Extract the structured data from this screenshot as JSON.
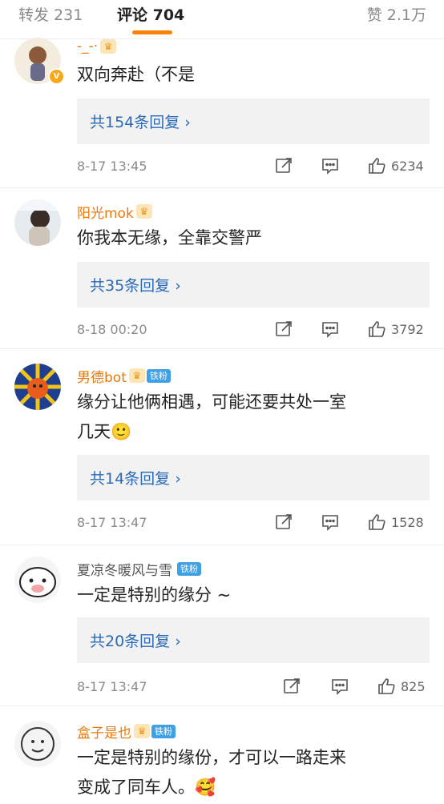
{
  "tabs": {
    "repost": "转发 231",
    "comment": "评论 704",
    "like": "赞 2.1万"
  },
  "comments": [
    {
      "username": "-_-·",
      "text_lines": [
        "双向奔赴（不是"
      ],
      "reply_label": "共154条回复 ›",
      "timestamp": "8-17 13:45",
      "likes": "6234",
      "verified": "V"
    },
    {
      "username": "阳光mok",
      "text_lines": [
        "你我本无缘，全靠交警严"
      ],
      "reply_label": "共35条回复 ›",
      "timestamp": "8-18 00:20",
      "likes": "3792"
    },
    {
      "username": "男德bot",
      "badge": "铁粉",
      "text_lines": [
        "缘分让他俩相遇，可能还要共处一室",
        "几天🙂"
      ],
      "reply_label": "共14条回复 ›",
      "timestamp": "8-17 13:47",
      "likes": "1528"
    },
    {
      "username": "夏凉冬暖风与雪",
      "badge": "铁粉",
      "text_lines": [
        "一定是特别的缘分 ~"
      ],
      "reply_label": "共20条回复 ›",
      "timestamp": "8-17 13:47",
      "likes": "825"
    },
    {
      "username": "盒子是也",
      "badge": "铁粉",
      "text_lines": [
        "一定是特别的缘份，才可以一路走来",
        "变成了同车人。🥰"
      ]
    }
  ],
  "icons": {
    "share": "share-icon",
    "comment": "comment-icon",
    "like": "thumbs-up-icon",
    "crown": "crown-icon"
  },
  "colors": {
    "accent": "#ff8200",
    "username": "#e8790c",
    "link": "#2a6ab8",
    "fan_badge": "#3ea1e6"
  }
}
